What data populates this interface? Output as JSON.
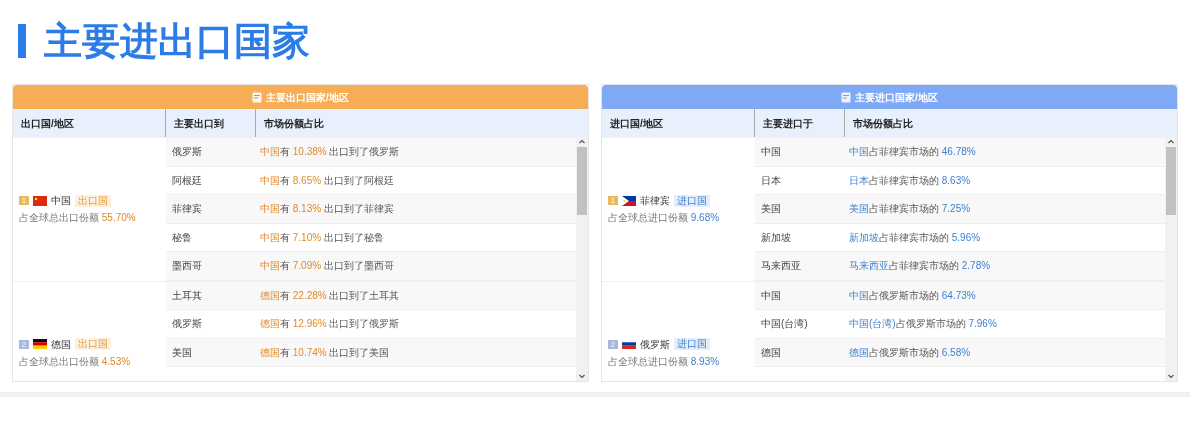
{
  "title": "主要进出口国家",
  "panels": [
    {
      "kind": "export",
      "header": "主要出口国家/地区",
      "columns": [
        "出口国/地区",
        "主要出口到",
        "市场份额占比"
      ],
      "groups": [
        {
          "rank": "1",
          "color": "#e9b95c",
          "kind": "cn",
          "country": "中国",
          "tag": "出口国",
          "share_label": "占全球总出口份额",
          "share": "55.70%",
          "rows": [
            {
              "partner": "俄罗斯",
              "subject": "中国",
              "text": "有",
              "percent": "10.38%",
              "tail": "出口到了俄罗斯"
            },
            {
              "partner": "阿根廷",
              "subject": "中国",
              "text": "有",
              "percent": "8.65%",
              "tail": "出口到了阿根廷"
            },
            {
              "partner": "菲律宾",
              "subject": "中国",
              "text": "有",
              "percent": "8.13%",
              "tail": "出口到了菲律宾"
            },
            {
              "partner": "秘鲁",
              "subject": "中国",
              "text": "有",
              "percent": "7.10%",
              "tail": "出口到了秘鲁"
            },
            {
              "partner": "墨西哥",
              "subject": "中国",
              "text": "有",
              "percent": "7.09%",
              "tail": "出口到了墨西哥"
            }
          ]
        },
        {
          "rank": "2",
          "color": "#a9b8e0",
          "kind": "de",
          "country": "德国",
          "tag": "出口国",
          "share_label": "占全球总出口份额",
          "share": "4.53%",
          "rows": [
            {
              "partner": "土耳其",
              "subject": "德国",
              "text": "有",
              "percent": "22.28%",
              "tail": "出口到了土耳其"
            },
            {
              "partner": "俄罗斯",
              "subject": "德国",
              "text": "有",
              "percent": "12.96%",
              "tail": "出口到了俄罗斯"
            },
            {
              "partner": "美国",
              "subject": "德国",
              "text": "有",
              "percent": "10.74%",
              "tail": "出口到了美国"
            }
          ]
        }
      ]
    },
    {
      "kind": "import",
      "header": "主要进口国家/地区",
      "columns": [
        "进口国/地区",
        "主要进口于",
        "市场份额占比"
      ],
      "groups": [
        {
          "rank": "1",
          "color": "#e9b95c",
          "kind": "ph",
          "country": "菲律宾",
          "tag": "进口国",
          "share_label": "占全球总进口份额",
          "share": "9.68%",
          "rows": [
            {
              "partner": "中国",
              "subject": "中国",
              "text": "占菲律宾市场的",
              "percent": "46.78%"
            },
            {
              "partner": "日本",
              "subject": "日本",
              "text": "占菲律宾市场的",
              "percent": "8.63%"
            },
            {
              "partner": "美国",
              "subject": "美国",
              "text": "占菲律宾市场的",
              "percent": "7.25%"
            },
            {
              "partner": "新加坡",
              "subject": "新加坡",
              "text": "占菲律宾市场的",
              "percent": "5.96%"
            },
            {
              "partner": "马来西亚",
              "subject": "马来西亚",
              "text": "占菲律宾市场的",
              "percent": "2.78%"
            }
          ]
        },
        {
          "rank": "2",
          "color": "#a9b8e0",
          "kind": "ru",
          "country": "俄罗斯",
          "tag": "进口国",
          "share_label": "占全球总进口份额",
          "share": "8.93%",
          "rows": [
            {
              "partner": "中国",
              "subject": "中国",
              "text": "占俄罗斯市场的",
              "percent": "64.73%"
            },
            {
              "partner": "中国(台湾)",
              "subject": "中国(台湾)",
              "text": "占俄罗斯市场的",
              "percent": "7.96%"
            },
            {
              "partner": "德国",
              "subject": "德国",
              "text": "占俄罗斯市场的",
              "percent": "6.58%"
            }
          ]
        }
      ]
    }
  ]
}
